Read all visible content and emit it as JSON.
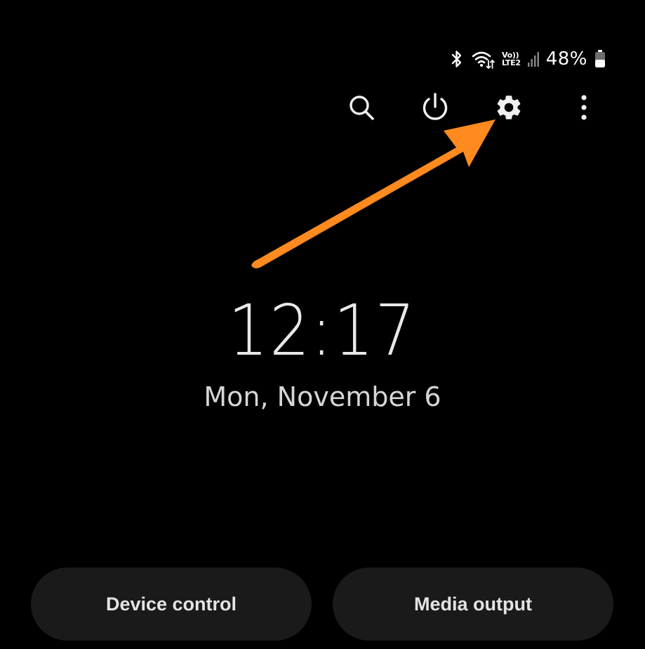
{
  "status_bar": {
    "bluetooth_icon": "bluetooth-icon",
    "wifi_icon": "wifi-icon",
    "volte_top": "Vo))",
    "volte_bottom": "LTE2",
    "signal_icon": "signal-icon",
    "battery_percent": "48%",
    "battery_icon": "battery-icon"
  },
  "quick_actions": {
    "search_icon": "search-icon",
    "power_icon": "power-icon",
    "settings_icon": "gear-icon",
    "more_icon": "more-vert-icon"
  },
  "annotation": {
    "arrow_color": "#ff8a1f"
  },
  "clock": {
    "time": "12:17",
    "date": "Mon, November 6"
  },
  "buttons": {
    "device_control": "Device control",
    "media_output": "Media output"
  },
  "colors": {
    "background": "#000000",
    "pill_background": "#1a1a1a",
    "accent_arrow": "#ff8a1f"
  }
}
